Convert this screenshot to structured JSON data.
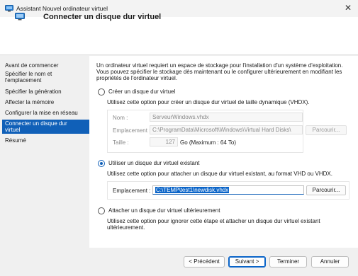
{
  "window": {
    "title": "Assistant Nouvel ordinateur virtuel",
    "close_glyph": "✕"
  },
  "header": {
    "title": "Connecter un disque dur virtuel",
    "icon": "virtual-disk-icon"
  },
  "sidebar": {
    "items": [
      {
        "label_lines": [
          "Avant de commencer"
        ],
        "active": false
      },
      {
        "label_lines": [
          "Spécifier le nom et",
          "l'emplacement"
        ],
        "active": false
      },
      {
        "label_lines": [
          "Spécifier la génération"
        ],
        "active": false
      },
      {
        "label_lines": [
          "Affecter la mémoire"
        ],
        "active": false
      },
      {
        "label_lines": [
          "Configurer la mise en réseau"
        ],
        "active": false
      },
      {
        "label_lines": [
          "Connecter un disque dur",
          "virtuel"
        ],
        "active": true
      },
      {
        "label_lines": [
          "Résumé"
        ],
        "active": false
      }
    ]
  },
  "intro": {
    "line1": "Un ordinateur virtuel requiert un espace de stockage pour l'installation d'un système d'exploitation.",
    "line2": "Vous pouvez spécifier le stockage dès maintenant ou le configurer ultérieurement en modifiant les",
    "line3": "propriétés de l'ordinateur virtuel."
  },
  "option_create": {
    "label": "Créer un disque dur virtuel",
    "selected": false,
    "description": "Utilisez cette option pour créer un disque dur virtuel de taille dynamique (VHDX).",
    "name_label": "Nom :",
    "name_value": "ServeurWindows.vhdx",
    "location_label": "Emplacement :",
    "location_value": "C:\\ProgramData\\Microsoft\\Windows\\Virtual Hard Disks\\",
    "browse_label": "Parcourir...",
    "size_label": "Taille :",
    "size_value": "127",
    "size_unit": "Go (Maximum : 64 To)"
  },
  "option_existing": {
    "label": "Utiliser un disque dur virtuel existant",
    "selected": true,
    "description": "Utilisez cette option pour attacher un disque dur virtuel existant, au format VHD ou VHDX.",
    "location_label": "Emplacement :",
    "location_value": "C:\\TEMP\\test1\\newdisk.vhdx",
    "browse_label": "Parcourir..."
  },
  "option_later": {
    "label": "Attacher un disque dur virtuel ultérieurement",
    "selected": false,
    "description_line1": "Utilisez cette option pour ignorer cette étape et attacher un disque dur virtuel existant",
    "description_line2": "ultérieurement."
  },
  "footer": {
    "previous": "< Précédent",
    "next": "Suivant >",
    "finish": "Terminer",
    "cancel": "Annuler"
  },
  "colors": {
    "accent": "#1060b8",
    "selection": "#0a64c8",
    "header_bg": "#ffffff",
    "dialog_bg": "#f0f0f0"
  }
}
